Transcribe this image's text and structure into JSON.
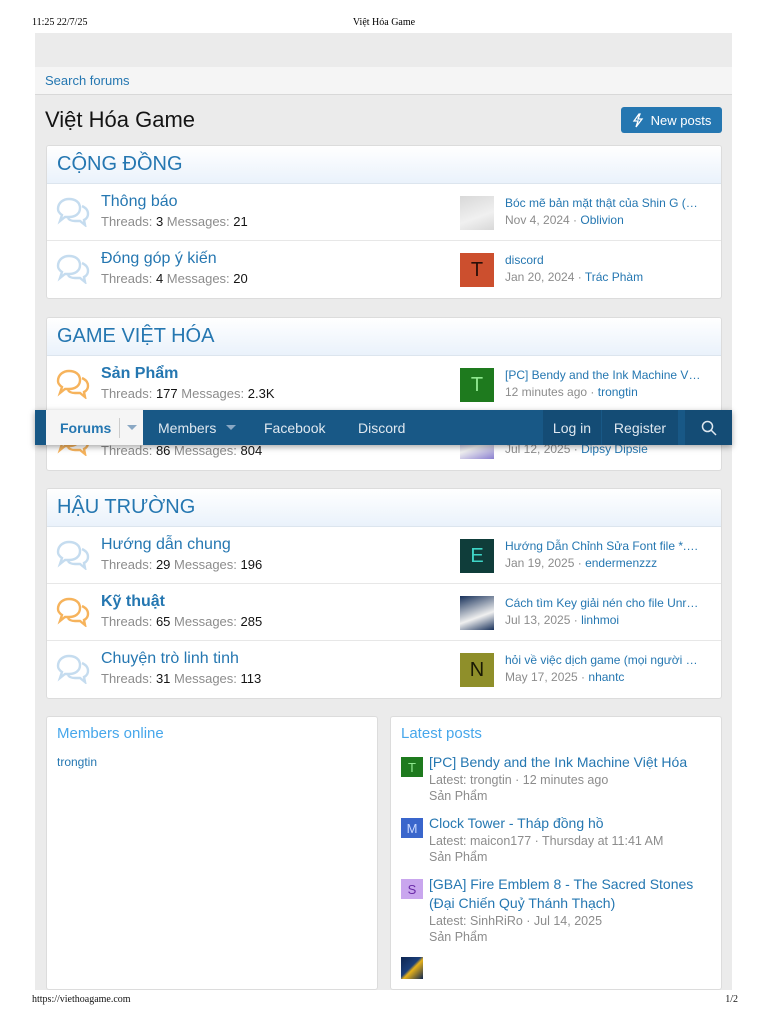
{
  "print_header": {
    "time": "11:25 22/7/25",
    "title": "Việt Hóa Game"
  },
  "print_footer": {
    "url": "https://viethoagame.com",
    "page": "1/2"
  },
  "search_forums": "Search forums",
  "page_title": "Việt Hóa Game",
  "new_posts": "New posts",
  "labels": {
    "threads": "Threads:",
    "messages": "Messages:"
  },
  "nav": {
    "forums": "Forums",
    "members": "Members",
    "facebook": "Facebook",
    "discord": "Discord",
    "login": "Log in",
    "register": "Register"
  },
  "categories": [
    {
      "title": "CỘNG ĐỒNG",
      "forums": [
        {
          "title": "Thông báo",
          "unread": false,
          "threads": "3",
          "messages": "21",
          "latest": "Bóc mẽ bản mặt thật của Shin G (…",
          "date": "Nov 4, 2024",
          "user": "Oblivion",
          "avatar": "img",
          "avatar_color": "#d8d8d8"
        },
        {
          "title": "Đóng góp ý kiến",
          "unread": false,
          "threads": "4",
          "messages": "20",
          "latest": "discord",
          "date": "Jan 20, 2024",
          "user": "Trác Phàm",
          "avatar": "T",
          "avatar_color": "#cc4f2e",
          "avatar_text_color": "#2a0f08"
        }
      ]
    },
    {
      "title": "GAME VIỆT HÓA",
      "forums": [
        {
          "title": "Sản Phẩm",
          "unread": true,
          "threads": "177",
          "messages": "2.3K",
          "latest": "[PC] Bendy and the Ink Machine V…",
          "date": "12 minutes ago",
          "user": "trongtin",
          "avatar": "T",
          "avatar_color": "#1e7a1e",
          "avatar_text_color": "#8fe88f"
        },
        {
          "title": "",
          "unread": true,
          "threads": "86",
          "messages": "804",
          "latest": "",
          "date": "Jul 12, 2025",
          "user": "Dipsy Dipsie",
          "avatar": "img",
          "avatar_color": "#8a7fd0"
        }
      ]
    },
    {
      "title": "HẬU TRƯỜNG",
      "forums": [
        {
          "title": "Hướng dẫn chung",
          "unread": false,
          "threads": "29",
          "messages": "196",
          "latest": "Hướng Dẫn Chỉnh Sửa Font file *.…",
          "date": "Jan 19, 2025",
          "user": "endermenzzz",
          "avatar": "E",
          "avatar_color": "#0f3d3a",
          "avatar_text_color": "#3fd6c8"
        },
        {
          "title": "Kỹ thuật",
          "unread": true,
          "threads": "65",
          "messages": "285",
          "latest": "Cách tìm Key giải nén cho file Unr…",
          "date": "Jul 13, 2025",
          "user": "linhmoi",
          "avatar": "img",
          "avatar_color": "#17305a"
        },
        {
          "title": "Chuyện trò linh tinh",
          "unread": false,
          "threads": "31",
          "messages": "113",
          "latest": "hỏi về việc dịch game (mọi người …",
          "date": "May 17, 2025",
          "user": "nhantc",
          "avatar": "N",
          "avatar_color": "#8f8f2a",
          "avatar_text_color": "#1a1a05"
        }
      ]
    }
  ],
  "members_online": {
    "title": "Members online",
    "members": [
      "trongtin"
    ]
  },
  "latest_posts": {
    "title": "Latest posts",
    "items": [
      {
        "title": "[PC] Bendy and the Ink Machine Việt Hóa",
        "meta": "Latest: trongtin · 12 minutes ago",
        "forum": "Sản Phẩm",
        "avatar": "T",
        "avatar_color": "#1e7a1e",
        "avatar_text_color": "#8fe88f"
      },
      {
        "title": "Clock Tower - Tháp đồng hồ",
        "meta": "Latest: maicon177 · Thursday at 11:41 AM",
        "forum": "Sản Phẩm",
        "avatar": "M",
        "avatar_color": "#3a66cc",
        "avatar_text_color": "#c8d8ff"
      },
      {
        "title": "[GBA] Fire Emblem 8 - The Sacred Stones (Đại Chiến Quỷ Thánh Thạch)",
        "meta": "Latest: SinhRiRo · Jul 14, 2025",
        "forum": "Sản Phẩm",
        "avatar": "S",
        "avatar_color": "#c9a6ee",
        "avatar_text_color": "#6a2aa8"
      }
    ]
  },
  "colors": {
    "accent": "#2577b1",
    "nav": "#185886",
    "read_icon": "#c5dcef",
    "unread_icon": "#f6b35c"
  }
}
